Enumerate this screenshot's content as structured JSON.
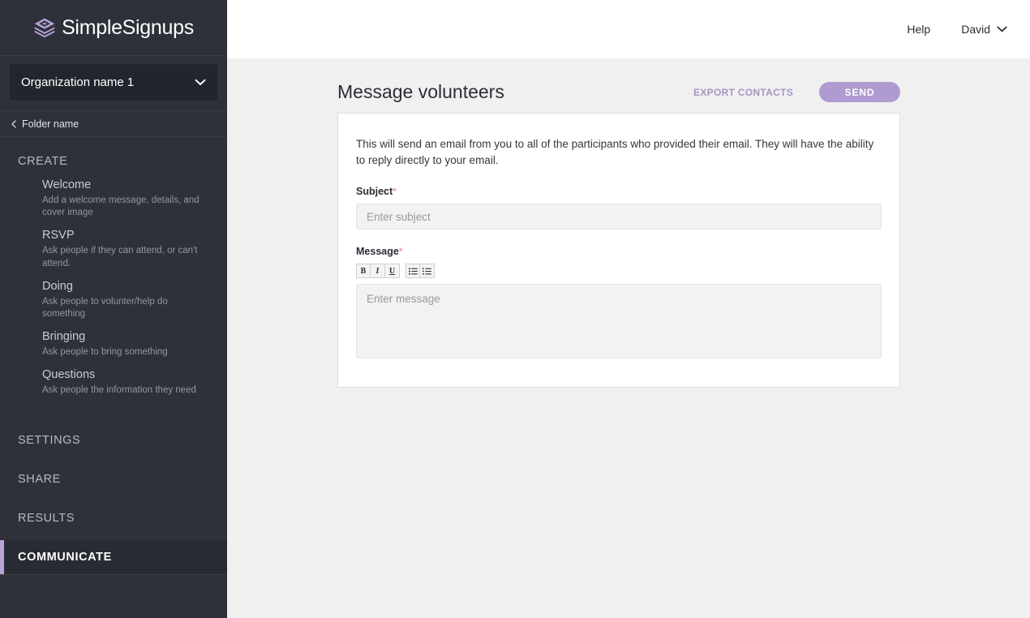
{
  "brand": {
    "name": "SimpleSignups",
    "logo_icon": "layers-stack-icon",
    "logo_color": "#b8a4d6"
  },
  "sidebar": {
    "org_selector": {
      "name": "Organization name 1",
      "chevron_icon": "chevron-down-icon"
    },
    "folder": {
      "back_icon": "chevron-left-icon",
      "label": "Folder name"
    },
    "create_section": {
      "heading": "CREATE",
      "items": [
        {
          "title": "Welcome",
          "desc": "Add a welcome message, details, and cover image"
        },
        {
          "title": "RSVP",
          "desc": "Ask people if they can attend, or can't attend."
        },
        {
          "title": "Doing",
          "desc": "Ask people to volunter/help do something"
        },
        {
          "title": "Bringing",
          "desc": "Ask people to bring something"
        },
        {
          "title": "Questions",
          "desc": "Ask people the information they need"
        }
      ]
    },
    "sections": [
      {
        "label": "SETTINGS",
        "active": false
      },
      {
        "label": "SHARE",
        "active": false
      },
      {
        "label": "RESULTS",
        "active": false
      },
      {
        "label": "COMMUNICATE",
        "active": true
      }
    ],
    "active_accent_color": "#b8a4d6"
  },
  "topbar": {
    "help_label": "Help",
    "user_name": "David",
    "user_chevron_icon": "chevron-down-icon"
  },
  "page": {
    "title": "Message volunteers",
    "export_label": "EXPORT CONTACTS",
    "send_label": "SEND",
    "send_color": "#ae9bd0",
    "export_color": "#a995c6"
  },
  "form": {
    "intro": "This will send an email from you to all of the participants who provided their email. They will have the ability to reply directly to your email.",
    "subject": {
      "label": "Subject",
      "required_mark": "*",
      "value": "",
      "placeholder": "Enter subject"
    },
    "message": {
      "label": "Message",
      "required_mark": "*",
      "value": "",
      "placeholder": "Enter message",
      "toolbar": [
        {
          "name": "bold-button",
          "glyph": "B"
        },
        {
          "name": "italic-button",
          "glyph": "I"
        },
        {
          "name": "underline-button",
          "glyph": "U"
        },
        {
          "name": "bullet-list-button",
          "glyph": ""
        },
        {
          "name": "numbered-list-button",
          "glyph": ""
        }
      ]
    }
  }
}
